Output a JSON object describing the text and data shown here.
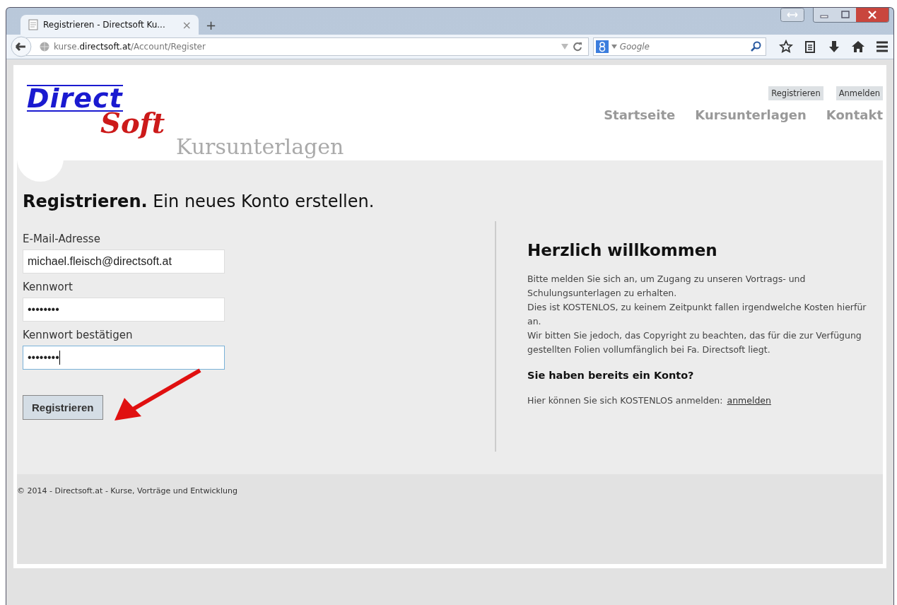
{
  "browser": {
    "tab": {
      "title": "Registrieren - Directsoft Ku...",
      "close": "×",
      "selected": true
    },
    "new_tab": "+",
    "url": {
      "subdomain": "kurse.",
      "domain": "directsoft.at",
      "path": "/Account/Register"
    },
    "search": {
      "placeholder": "Google"
    }
  },
  "header": {
    "logo_top": "Direct",
    "logo_bottom": "Soft",
    "subtitle": "Kursunterlagen",
    "account_links": [
      "Registrieren",
      "Anmelden"
    ],
    "nav": [
      "Startseite",
      "Kursunterlagen",
      "Kontakt"
    ]
  },
  "form": {
    "title": "Registrieren.",
    "subtitle": "Ein neues Konto erstellen.",
    "fields": [
      {
        "label": "E-Mail-Adresse",
        "value": "michael.fleisch@directsoft.at",
        "focused": false
      },
      {
        "label": "Kennwort",
        "value": "••••••••",
        "focused": false
      },
      {
        "label": "Kennwort bestätigen",
        "value": "••••••••",
        "focused": true
      }
    ],
    "submit": "Registrieren"
  },
  "welcome": {
    "title": "Herzlich willkommen",
    "paragraphs": [
      "Bitte melden Sie sich an, um Zugang zu unseren Vortrags- und Schulungsunterlagen zu erhalten.",
      "Dies ist KOSTENLOS, zu keinem Zeitpunkt fallen irgendwelche Kosten hierfür an.",
      "Wir bitten Sie jedoch, das Copyright zu beachten, das für die zur Verfügung gestellten Folien vollumfänglich bei Fa. Directsoft liegt."
    ],
    "login_title": "Sie haben bereits ein Konto?",
    "login_text": "Hier können Sie sich KOSTENLOS anmelden:",
    "login_link": "anmelden"
  },
  "footer": "© 2014 - Directsoft.at - Kurse, Vorträge und Entwicklung"
}
